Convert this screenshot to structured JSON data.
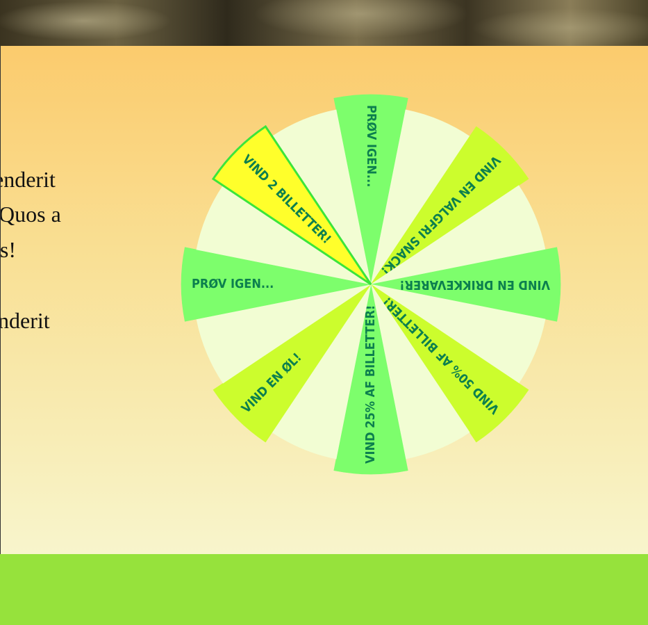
{
  "intro": {
    "lines": [
      "enderit",
      "Quos a",
      "ls!",
      "nderit"
    ]
  },
  "wheel": {
    "colors": {
      "green": "#7dfe6c",
      "pale": "#f2fdd3",
      "lime": "#ccfd2d",
      "highlight": "#ffff2b",
      "highlight_stroke": "#3be53b",
      "label": "#0c7f4e"
    },
    "segments": [
      {
        "color": "green",
        "label": "PRØV IGEN..."
      },
      {
        "color": "pale",
        "label": ""
      },
      {
        "color": "lime",
        "label": "VIND EN VALGFRI SNACK!"
      },
      {
        "color": "pale",
        "label": ""
      },
      {
        "color": "green",
        "label": "VIND EN DRIKKEVARER!"
      },
      {
        "color": "pale",
        "label": ""
      },
      {
        "color": "lime",
        "label": "VIND 50% AF BILLETTER!"
      },
      {
        "color": "pale",
        "label": ""
      },
      {
        "color": "green",
        "label": "VIND 25% AF BILLETTER!"
      },
      {
        "color": "pale",
        "label": ""
      },
      {
        "color": "lime",
        "label": "VIND EN ØL!"
      },
      {
        "color": "pale",
        "label": ""
      },
      {
        "color": "green",
        "label": "PRØV IGEN..."
      },
      {
        "color": "pale",
        "label": ""
      },
      {
        "color": "highlight",
        "label": "VIND 2 BILLETTER!",
        "selected": true
      },
      {
        "color": "pale",
        "label": ""
      }
    ]
  }
}
